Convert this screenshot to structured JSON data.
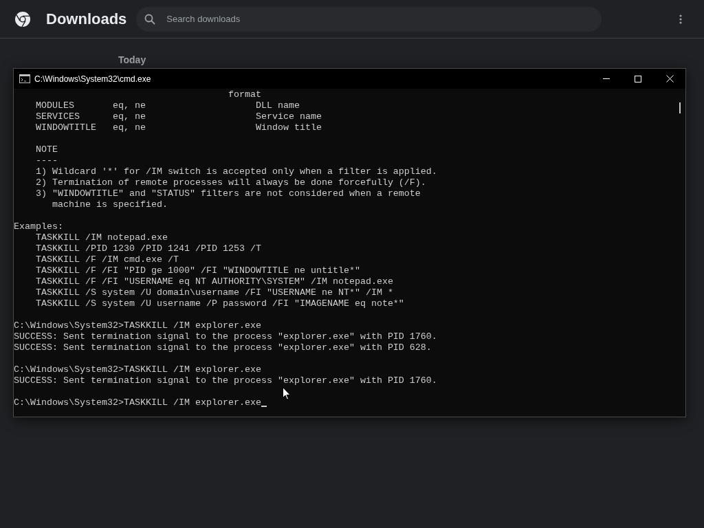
{
  "header": {
    "title": "Downloads",
    "search": {
      "placeholder": "Search downloads"
    }
  },
  "section_heading": "Today",
  "console": {
    "title": "C:\\Windows\\System32\\cmd.exe",
    "cursor_visible": true,
    "blocks": [
      [
        "                                       format",
        "    MODULES       eq, ne                    DLL name",
        "    SERVICES      eq, ne                    Service name",
        "    WINDOWTITLE   eq, ne                    Window title"
      ],
      [
        "    NOTE",
        "    ----",
        "    1) Wildcard '*' for /IM switch is accepted only when a filter is applied.",
        "    2) Termination of remote processes will always be done forcefully (/F).",
        "    3) \"WINDOWTITLE\" and \"STATUS\" filters are not considered when a remote",
        "       machine is specified."
      ],
      [
        "Examples:",
        "    TASKKILL /IM notepad.exe",
        "    TASKKILL /PID 1230 /PID 1241 /PID 1253 /T",
        "    TASKKILL /F /IM cmd.exe /T",
        "    TASKKILL /F /FI \"PID ge 1000\" /FI \"WINDOWTITLE ne untitle*\"",
        "    TASKKILL /F /FI \"USERNAME eq NT AUTHORITY\\SYSTEM\" /IM notepad.exe",
        "    TASKKILL /S system /U domain\\username /FI \"USERNAME ne NT*\" /IM *",
        "    TASKKILL /S system /U username /P password /FI \"IMAGENAME eq note*\""
      ],
      [
        "C:\\Windows\\System32>TASKKILL /IM explorer.exe",
        "SUCCESS: Sent termination signal to the process \"explorer.exe\" with PID 1760.",
        "SUCCESS: Sent termination signal to the process \"explorer.exe\" with PID 628."
      ],
      [
        "C:\\Windows\\System32>TASKKILL /IM explorer.exe",
        "SUCCESS: Sent termination signal to the process \"explorer.exe\" with PID 1760."
      ],
      [
        "C:\\Windows\\System32>TASKKILL /IM explorer.exe"
      ]
    ]
  }
}
